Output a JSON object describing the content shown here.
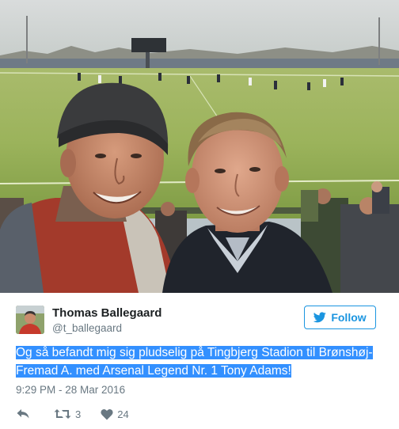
{
  "photo": {
    "alt_icon": "selfie-stadium-photo"
  },
  "tweet": {
    "display_name": "Thomas Ballegaard",
    "handle": "@t_ballegaard",
    "follow_label": "Follow",
    "text": "Og så befandt mig sig pludselig på Tingbjerg Stadion til Brønshøj-Fremad A. med Arsenal Legend Nr. 1 Tony Adams!",
    "timestamp": "9:29 PM - 28 Mar 2016",
    "retweet_count": "3",
    "like_count": "24"
  },
  "icons": {
    "follow": "twitter-bird-icon",
    "reply": "reply-icon",
    "retweet": "retweet-icon",
    "like": "heart-icon"
  },
  "colors": {
    "accent": "#1b95e0",
    "selection": "#3390ff",
    "text": "#1c2022",
    "muted": "#697882"
  }
}
